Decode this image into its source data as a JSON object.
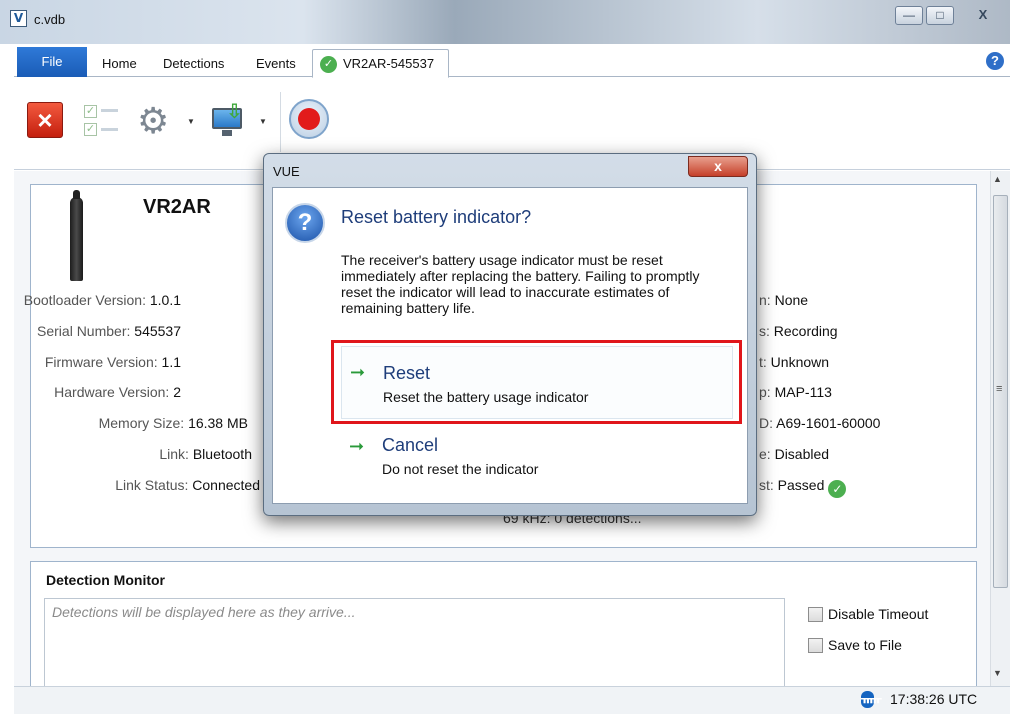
{
  "window": {
    "app_icon": "V",
    "title": "c.vdb",
    "minimize_icon": "minimize-icon",
    "maximize_icon": "maximize-icon",
    "close_label": "X"
  },
  "ribbon": {
    "file_tab": "File",
    "tabs": [
      "Home",
      "Detections",
      "Events"
    ],
    "active_tab": "VR2AR-545537",
    "help_label": "?",
    "toolbar_icons": [
      "close-icon",
      "checklist-icon",
      "gear-icon",
      "monitor-download-icon",
      "record-icon"
    ]
  },
  "device": {
    "name": "VR2AR",
    "left_fields": [
      {
        "label": "Bootloader Version:",
        "value": "1.0.1"
      },
      {
        "label": "Serial Number:",
        "value": "545537"
      },
      {
        "label": "Firmware Version:",
        "value": "1.1"
      },
      {
        "label": "Hardware Version:",
        "value": "2"
      },
      {
        "label": "Memory Size:",
        "value": "16.38 MB"
      },
      {
        "label": "Link:",
        "value": "Bluetooth"
      },
      {
        "label": "Link Status:",
        "value": "Connected"
      }
    ],
    "right_fields": [
      {
        "label": "n:",
        "value": "None"
      },
      {
        "label": "s:",
        "value": "Recording"
      },
      {
        "label": "t:",
        "value": "Unknown"
      },
      {
        "label": "p:",
        "value": "MAP-113"
      },
      {
        "label": "D:",
        "value": "A69-1601-60000"
      },
      {
        "label": "e:",
        "value": "Disabled"
      },
      {
        "label": "st:",
        "value": "Passed"
      }
    ],
    "detection_summary": "69 kHz: 0 detections..."
  },
  "detection_monitor": {
    "title": "Detection Monitor",
    "placeholder": "Detections will be displayed here as they arrive...",
    "options": [
      "Disable Timeout",
      "Save to File"
    ]
  },
  "statusbar": {
    "bluetooth_icon": "bluetooth-icon",
    "time": "17:38:26 UTC"
  },
  "dialog": {
    "title": "VUE",
    "close_label": "x",
    "icon": "question-icon",
    "heading": "Reset battery indicator?",
    "message": "The receiver's battery usage indicator must be reset immediately after replacing the battery. Failing to promptly reset the indicator will lead to inaccurate estimates of remaining battery life.",
    "options": [
      {
        "label": "Reset",
        "description": "Reset the battery usage indicator"
      },
      {
        "label": "Cancel",
        "description": "Do not reset the indicator"
      }
    ],
    "highlight_color": "#e0161b"
  },
  "colors": {
    "file_tab": "#1a5cb6",
    "accent_text": "#1e3d7a",
    "ok_green": "#4caf50"
  }
}
